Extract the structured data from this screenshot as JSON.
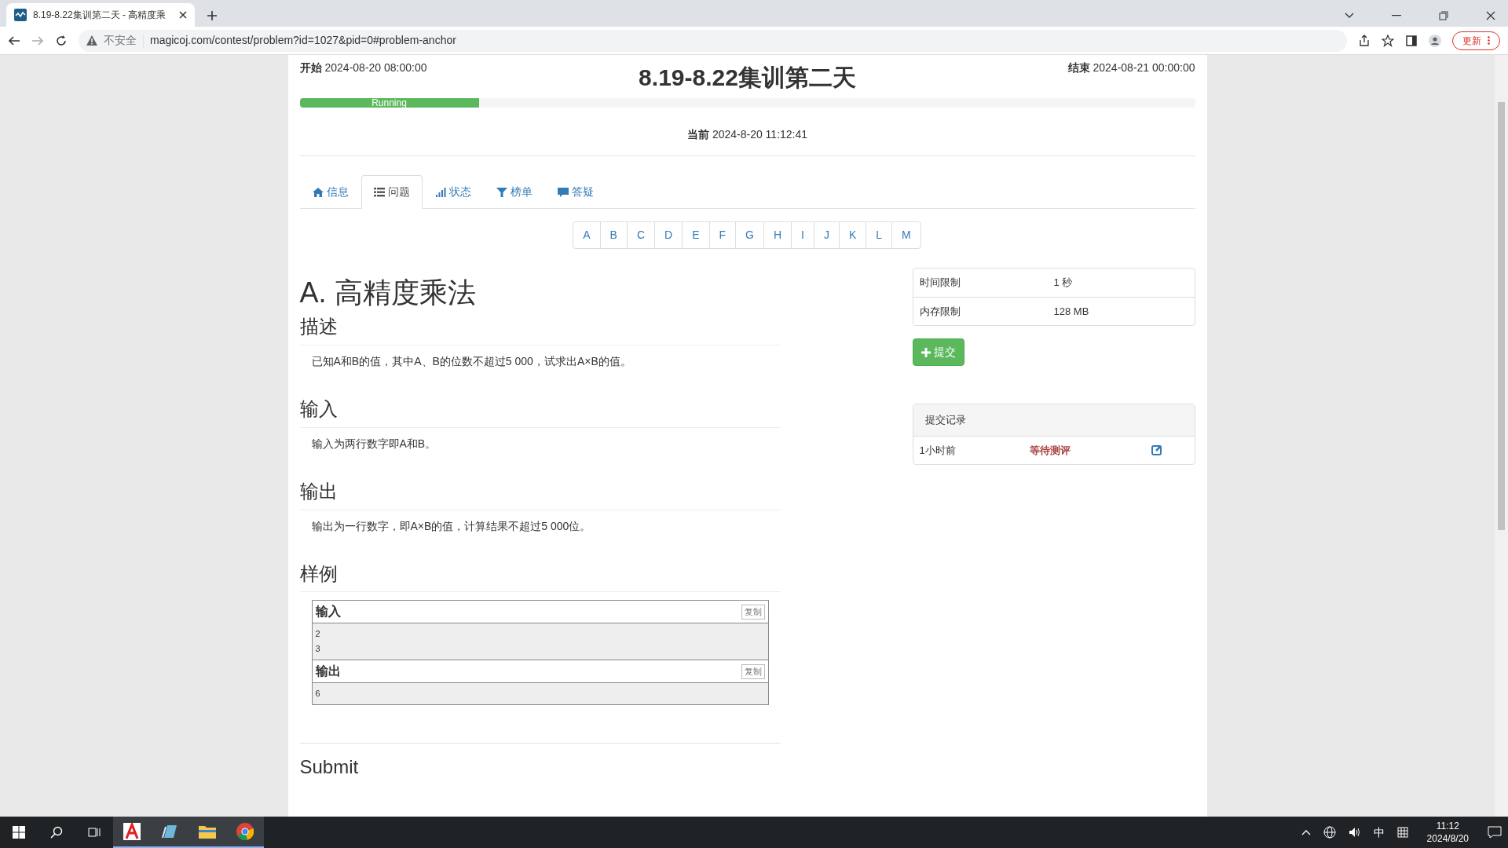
{
  "browser": {
    "tab_title": "8.19-8.22集训第二天 - 高精度乘",
    "security_label": "不安全",
    "url": "magicoj.com/contest/problem?id=1027&pid=0#problem-anchor",
    "update_button": "更新"
  },
  "contest": {
    "start_label": "开始",
    "start_time": "2024-08-20 08:00:00",
    "title": "8.19-8.22集训第二天",
    "end_label": "结束",
    "end_time": "2024-08-21 00:00:00",
    "progress": {
      "label": "Running",
      "level": 0.2
    },
    "current_label": "当前",
    "current_time": "2024-8-20 11:12:41"
  },
  "tabs": [
    {
      "label": "信息",
      "selected": false
    },
    {
      "label": "问题",
      "selected": true
    },
    {
      "label": "状态",
      "selected": false
    },
    {
      "label": "榜单",
      "selected": false
    },
    {
      "label": "答疑",
      "selected": false
    }
  ],
  "problem_letters": [
    "A",
    "B",
    "C",
    "D",
    "E",
    "F",
    "G",
    "H",
    "I",
    "J",
    "K",
    "L",
    "M"
  ],
  "problem": {
    "title": "A. 高精度乘法",
    "sections": [
      {
        "heading": "描述",
        "text": "已知A和B的值，其中A、B的位数不超过5 000，试求出A×B的值。"
      },
      {
        "heading": "输入",
        "text": "输入为两行数字即A和B。"
      },
      {
        "heading": "输出",
        "text": "输出为一行数字，即A×B的值，计算结果不超过5 000位。"
      }
    ],
    "sample": {
      "heading": "样例",
      "blocks": [
        {
          "label": "输入",
          "copy_button": "复制",
          "lines": [
            "2",
            "3"
          ]
        },
        {
          "label": "输出",
          "copy_button": "复制",
          "lines": [
            "6"
          ]
        }
      ]
    },
    "submit_heading": "Submit"
  },
  "sidebar": {
    "limits": [
      {
        "label": "时间限制",
        "value": "1 秒"
      },
      {
        "label": "内存限制",
        "value": "128 MB"
      }
    ],
    "submit_button": "提交",
    "records": {
      "heading": "提交记录",
      "rows": [
        {
          "time": "1小时前",
          "status": "等待测评"
        }
      ]
    }
  },
  "taskbar": {
    "ime": "中",
    "time": "11:12",
    "date": "2024/8/20"
  }
}
